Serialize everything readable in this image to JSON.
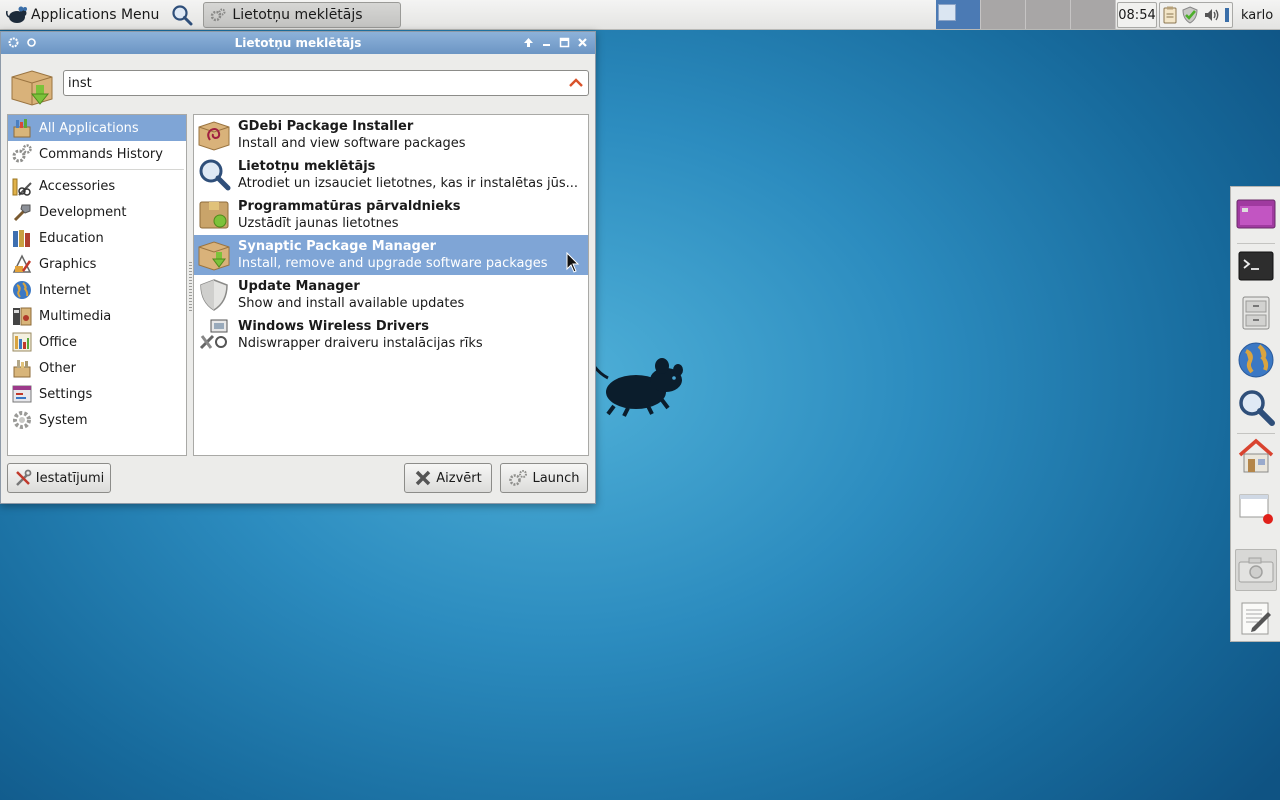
{
  "panel": {
    "app_menu_label": "Applications Menu",
    "task_title": "Lietotņu meklētājs",
    "clock": "08:54",
    "username": "karlo"
  },
  "window": {
    "title": "Lietotņu meklētājs"
  },
  "search": {
    "value": "inst"
  },
  "categories": [
    {
      "label": "All Applications",
      "icon": "all-apps-icon",
      "selected": true
    },
    {
      "label": "Commands History",
      "icon": "gears-icon",
      "selected": false
    },
    {
      "label": "Accessories",
      "icon": "accessories-icon",
      "selected": false
    },
    {
      "label": "Development",
      "icon": "development-icon",
      "selected": false
    },
    {
      "label": "Education",
      "icon": "education-icon",
      "selected": false
    },
    {
      "label": "Graphics",
      "icon": "graphics-icon",
      "selected": false
    },
    {
      "label": "Internet",
      "icon": "globe-icon",
      "selected": false
    },
    {
      "label": "Multimedia",
      "icon": "multimedia-icon",
      "selected": false
    },
    {
      "label": "Office",
      "icon": "office-icon",
      "selected": false
    },
    {
      "label": "Other",
      "icon": "other-icon",
      "selected": false
    },
    {
      "label": "Settings",
      "icon": "settings-icon",
      "selected": false
    },
    {
      "label": "System",
      "icon": "system-icon",
      "selected": false
    }
  ],
  "apps": [
    {
      "name": "GDebi Package Installer",
      "desc": "Install and view software packages",
      "icon": "debian-package-icon",
      "selected": false
    },
    {
      "name": "Lietotņu meklētājs",
      "desc": "Atrodiet un izsauciet lietotnes, kas ir instalētas jūs...",
      "icon": "magnifier-icon",
      "selected": false
    },
    {
      "name": "Programmatūras pārvaldnieks",
      "desc": "Uzstādīt jaunas lietotnes",
      "icon": "software-center-icon",
      "selected": false
    },
    {
      "name": "Synaptic Package Manager",
      "desc": "Install, remove and upgrade software packages",
      "icon": "package-install-icon",
      "selected": true
    },
    {
      "name": "Update Manager",
      "desc": "Show and install available updates",
      "icon": "shield-icon",
      "selected": false
    },
    {
      "name": "Windows Wireless Drivers",
      "desc": "Ndiswrapper draiveru instalācijas rīks",
      "icon": "network-tools-icon",
      "selected": false
    }
  ],
  "buttons": {
    "settings": "Iestatījumi",
    "close": "Aizvērt",
    "launch": "Launch"
  },
  "colors": {
    "selection": "#7fa5d6",
    "titlebar": "#7aa1cd",
    "active_workspace": "#4b7ab4"
  }
}
